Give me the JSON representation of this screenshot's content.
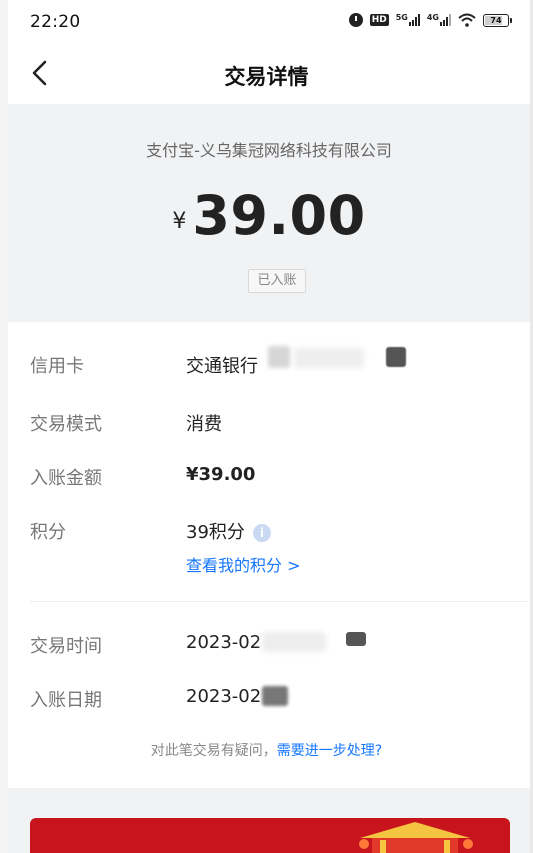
{
  "status_bar": {
    "time": "22:20",
    "network_1": "5G",
    "network_2": "4G",
    "battery": "74"
  },
  "nav": {
    "title": "交易详情",
    "back_icon": "chevron-left-icon"
  },
  "summary": {
    "merchant": "支付宝-义乌集冠网络科技有限公司",
    "currency": "¥",
    "amount": "39.00",
    "status": "已入账"
  },
  "details": {
    "card": {
      "label": "信用卡",
      "value": "交通银行"
    },
    "mode": {
      "label": "交易模式",
      "value": "消费"
    },
    "posted_amount": {
      "label": "入账金额",
      "value": "¥39.00"
    },
    "points": {
      "label": "积分",
      "value": "39积分",
      "link": "查看我的积分 >"
    },
    "trade_time": {
      "label": "交易时间",
      "value": "2023-02"
    },
    "posted_date": {
      "label": "入账日期",
      "value": "2023-02"
    }
  },
  "help": {
    "question": "对此笔交易有疑问，",
    "link": "需要进一步处理?"
  },
  "colors": {
    "accent": "#1677ff",
    "header_bg": "#f1f2f4",
    "banner_red": "#c8141c"
  }
}
